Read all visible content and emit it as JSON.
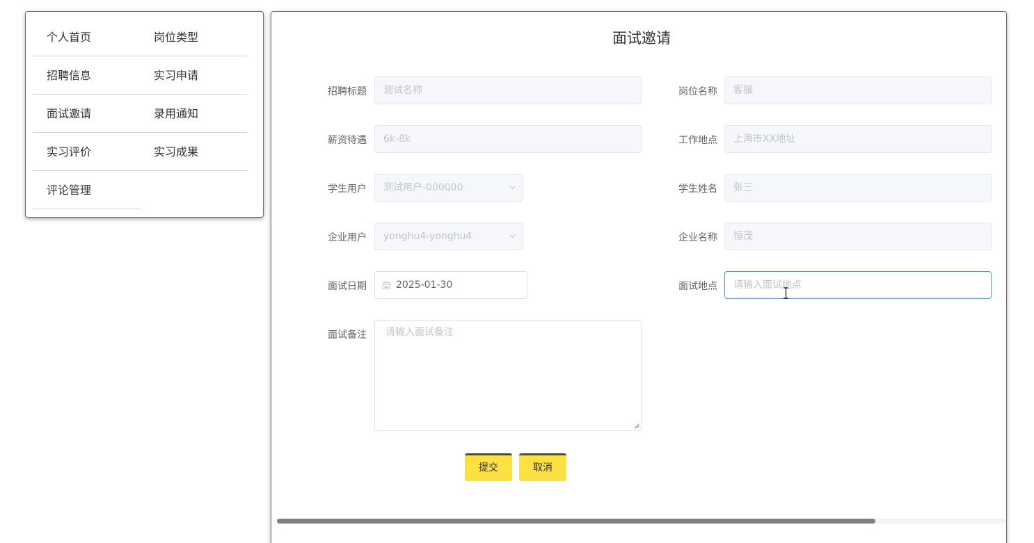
{
  "nav": {
    "items": [
      {
        "label": "个人首页"
      },
      {
        "label": "岗位类型"
      },
      {
        "label": "招聘信息"
      },
      {
        "label": "实习申请"
      },
      {
        "label": "面试邀请"
      },
      {
        "label": "录用通知"
      },
      {
        "label": "实习评价"
      },
      {
        "label": "实习成果"
      },
      {
        "label": "评论管理"
      }
    ]
  },
  "form": {
    "title": "面试邀请",
    "fields": {
      "recruit_title": {
        "label": "招聘标题",
        "value": "测试名称"
      },
      "position_name": {
        "label": "岗位名称",
        "value": "客服"
      },
      "salary": {
        "label": "薪资待遇",
        "value": "6k-8k"
      },
      "work_location": {
        "label": "工作地点",
        "value": "上海市XX地址"
      },
      "student_user": {
        "label": "学生用户",
        "value": "测试用户-000000"
      },
      "student_name": {
        "label": "学生姓名",
        "value": "张三"
      },
      "company_user": {
        "label": "企业用户",
        "value": "yonghu4-yonghu4"
      },
      "company_name": {
        "label": "企业名称",
        "value": "恒茂"
      },
      "interview_date": {
        "label": "面试日期",
        "value": "2025-01-30"
      },
      "interview_location": {
        "label": "面试地点",
        "placeholder": "请输入面试地点"
      },
      "interview_notes": {
        "label": "面试备注",
        "placeholder": "请输入面试备注"
      }
    },
    "buttons": {
      "submit": "提交",
      "cancel": "取消"
    }
  },
  "colors": {
    "button_bg": "#fbe142",
    "focus_border": "#409eff",
    "disabled_bg": "#f5f7fa"
  }
}
